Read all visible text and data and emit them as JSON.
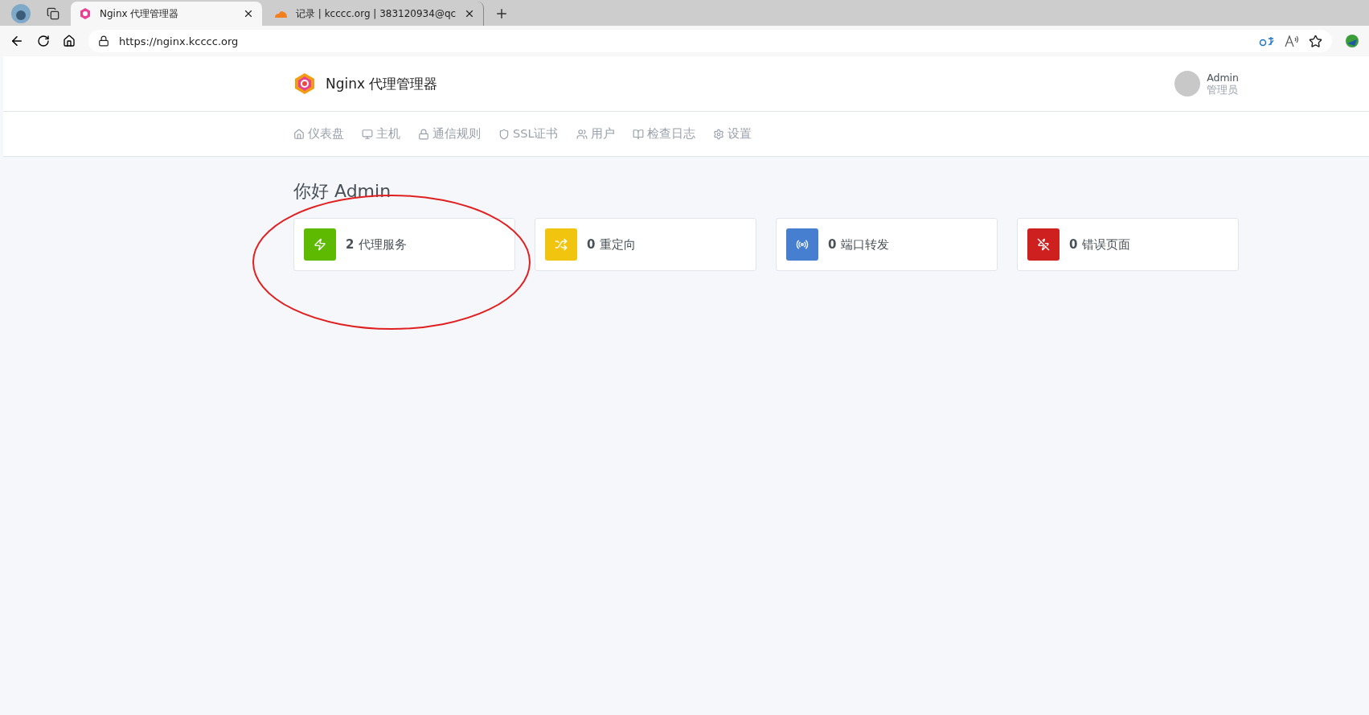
{
  "browser": {
    "tabs": [
      {
        "title": "Nginx 代理管理器",
        "selected": true,
        "kind": "nginx"
      },
      {
        "title": "记录 | kcccc.org | 383120934@qc",
        "selected": false,
        "kind": "cloud"
      }
    ],
    "address": "https://nginx.kcccc.org"
  },
  "header": {
    "app_title": "Nginx 代理管理器",
    "user": {
      "name": "Admin",
      "role": "管理员"
    }
  },
  "nav": [
    {
      "label": "仪表盘",
      "kind": "home"
    },
    {
      "label": "主机",
      "kind": "monitor"
    },
    {
      "label": "通信规则",
      "kind": "lock"
    },
    {
      "label": "SSL证书",
      "kind": "shield"
    },
    {
      "label": "用户",
      "kind": "users"
    },
    {
      "label": "检查日志",
      "kind": "book"
    },
    {
      "label": "设置",
      "kind": "settings"
    }
  ],
  "greeting": "你好 Admin",
  "stats": [
    {
      "count": "2",
      "label": "代理服务",
      "kind": "zap",
      "color": "#5eba00"
    },
    {
      "count": "0",
      "label": "重定向",
      "kind": "shuffle",
      "color": "#f1c40f"
    },
    {
      "count": "0",
      "label": "端口转发",
      "kind": "radio",
      "color": "#467fcf"
    },
    {
      "count": "0",
      "label": "错误页面",
      "kind": "zapoff",
      "color": "#cd201f"
    }
  ],
  "annotation": {
    "kind": "ellipse"
  }
}
